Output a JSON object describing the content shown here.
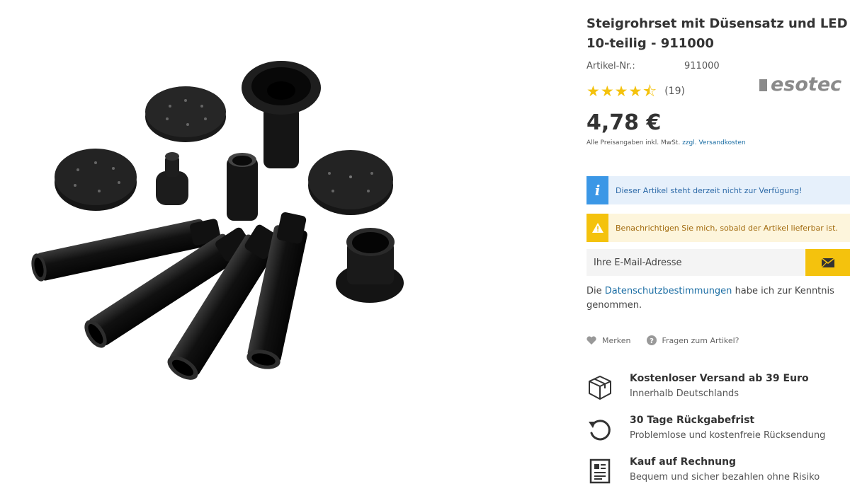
{
  "product": {
    "title_line1": "Steigrohrset mit Düsensatz und LED Halte",
    "title_line2": "10-teilig - 911000",
    "article_label": "Artikel-Nr.:",
    "article_value": "911000",
    "brand": "esotec",
    "rating": {
      "stars": "★★★★⯪",
      "value": 4.5,
      "count_text": "(19)"
    },
    "price": "4,78 €",
    "price_note_text": "Alle Preisangaben inkl. MwSt.",
    "price_note_link1": "zzgl.",
    "price_note_link2": "Versandkosten"
  },
  "alerts": {
    "info_text": "Dieser Artikel steht derzeit nicht zur Verfügung!",
    "warn_text": "Benachrichtigen Sie mich, sobald der Artikel lieferbar ist.",
    "info_icon": "info-icon",
    "warn_icon": "warning-icon"
  },
  "notify": {
    "email_placeholder": "Ihre E-Mail-Adresse",
    "submit_icon": "envelope-icon"
  },
  "privacy": {
    "prefix": "Die ",
    "link": "Datenschutzbestimmungen",
    "suffix": " habe ich zur Kenntnis genommen."
  },
  "actions": {
    "remember_label": "Merken",
    "question_label": "Fragen zum Artikel?"
  },
  "usps": [
    {
      "title": "Kostenloser Versand ab 39 Euro",
      "subtitle": "Innerhalb Deutschlands",
      "icon": "box-icon"
    },
    {
      "title": "30 Tage Rückgabefrist",
      "subtitle": "Problemlose und kostenfreie Rücksendung",
      "icon": "return-icon"
    },
    {
      "title": "Kauf auf Rechnung",
      "subtitle": "Bequem und sicher bezahlen ohne Risiko",
      "icon": "invoice-icon"
    }
  ],
  "colors": {
    "accent_yellow": "#f4c20d",
    "info_blue": "#3b97e6",
    "link_blue": "#1c6ea4",
    "brand_gray": "#8a8a8a"
  }
}
